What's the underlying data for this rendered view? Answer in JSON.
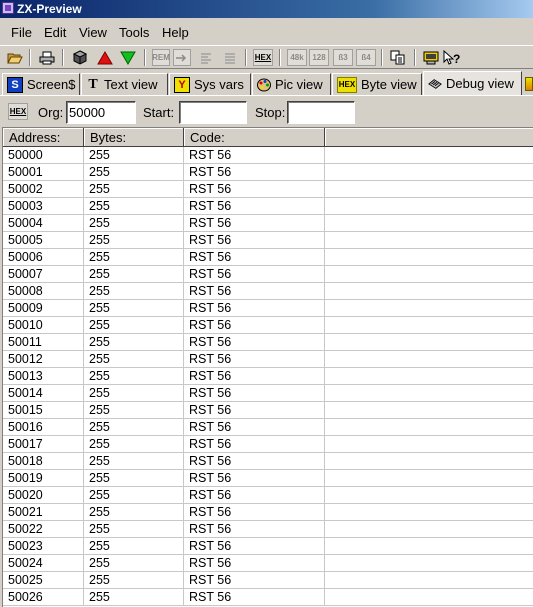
{
  "window": {
    "title": "ZX-Preview"
  },
  "menu": [
    "File",
    "Edit",
    "View",
    "Tools",
    "Help"
  ],
  "toolbar": {
    "open_icon": "folder-open-icon",
    "print_icon": "printer-icon",
    "cube_icon": "cube-icon",
    "up_icon": "red-up-arrow-icon",
    "down_icon": "green-down-arrow-icon",
    "rem_label": "REM",
    "hex_label": "HEX",
    "k48_label": "48k",
    "k128_label": "128",
    "b83_label": "ß3",
    "b84_label": "ß4",
    "copy_icon": "copy-icon",
    "help_icon": "whats-this-help-icon"
  },
  "tabs": [
    {
      "label": "Screen$",
      "icon": "screen-s-icon"
    },
    {
      "label": "Text view",
      "icon": "text-t-icon"
    },
    {
      "label": "Sys vars",
      "icon": "sys-vars-icon"
    },
    {
      "label": "Pic view",
      "icon": "palette-icon"
    },
    {
      "label": "Byte view",
      "icon": "hex-icon"
    },
    {
      "label": "Debug view",
      "icon": "debug-chip-icon",
      "active": true
    }
  ],
  "orgbar": {
    "hex_label": "HEX",
    "org_label": "Org:",
    "org_value": "50000",
    "start_label": "Start:",
    "start_value": "",
    "stop_label": "Stop:",
    "stop_value": ""
  },
  "table": {
    "columns": [
      "Address:",
      "Bytes:",
      "Code:"
    ],
    "rows": [
      [
        "50000",
        "255",
        "RST 56"
      ],
      [
        "50001",
        "255",
        "RST 56"
      ],
      [
        "50002",
        "255",
        "RST 56"
      ],
      [
        "50003",
        "255",
        "RST 56"
      ],
      [
        "50004",
        "255",
        "RST 56"
      ],
      [
        "50005",
        "255",
        "RST 56"
      ],
      [
        "50006",
        "255",
        "RST 56"
      ],
      [
        "50007",
        "255",
        "RST 56"
      ],
      [
        "50008",
        "255",
        "RST 56"
      ],
      [
        "50009",
        "255",
        "RST 56"
      ],
      [
        "50010",
        "255",
        "RST 56"
      ],
      [
        "50011",
        "255",
        "RST 56"
      ],
      [
        "50012",
        "255",
        "RST 56"
      ],
      [
        "50013",
        "255",
        "RST 56"
      ],
      [
        "50014",
        "255",
        "RST 56"
      ],
      [
        "50015",
        "255",
        "RST 56"
      ],
      [
        "50016",
        "255",
        "RST 56"
      ],
      [
        "50017",
        "255",
        "RST 56"
      ],
      [
        "50018",
        "255",
        "RST 56"
      ],
      [
        "50019",
        "255",
        "RST 56"
      ],
      [
        "50020",
        "255",
        "RST 56"
      ],
      [
        "50021",
        "255",
        "RST 56"
      ],
      [
        "50022",
        "255",
        "RST 56"
      ],
      [
        "50023",
        "255",
        "RST 56"
      ],
      [
        "50024",
        "255",
        "RST 56"
      ],
      [
        "50025",
        "255",
        "RST 56"
      ],
      [
        "50026",
        "255",
        "RST 56"
      ]
    ]
  }
}
